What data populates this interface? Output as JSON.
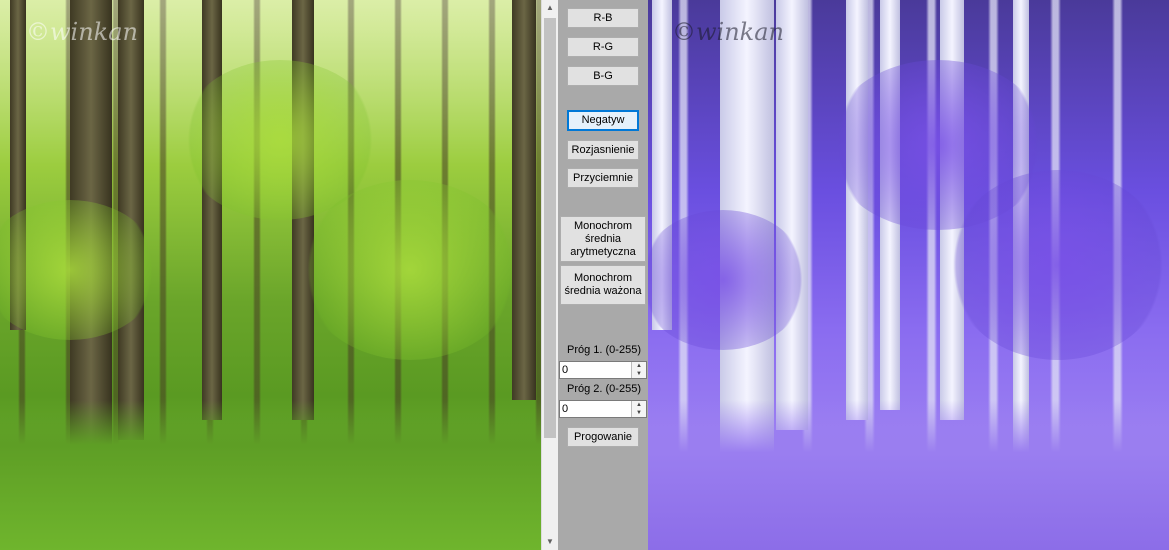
{
  "images": {
    "original_watermark": "©winkan",
    "negative_watermark": "©winkan"
  },
  "controls": {
    "rb": "R-B",
    "rg": "R-G",
    "bg": "B-G",
    "negatyw": "Negatyw",
    "rozjasnienie": "Rozjasnienie",
    "przyciemnie": "Przyciemnie",
    "mono_arith_line1": "Monochrom",
    "mono_arith_line2": "średnia",
    "mono_arith_line3": "arytmetyczna",
    "mono_weighted_line1": "Monochrom",
    "mono_weighted_line2": "średnia ważona",
    "prog1_label": "Próg 1. (0-255)",
    "prog1_value": "0",
    "prog2_label": "Próg 2. (0-255)",
    "prog2_value": "0",
    "progowanie": "Progowanie"
  },
  "icons": {
    "scroll_up": "arrow-up-icon",
    "scroll_down": "arrow-down-icon",
    "spin_up": "spin-up-icon",
    "spin_down": "spin-down-icon"
  },
  "colors": {
    "focus": "#0078d7",
    "panel": "#a9a9a9",
    "button": "#e1e1e1"
  }
}
